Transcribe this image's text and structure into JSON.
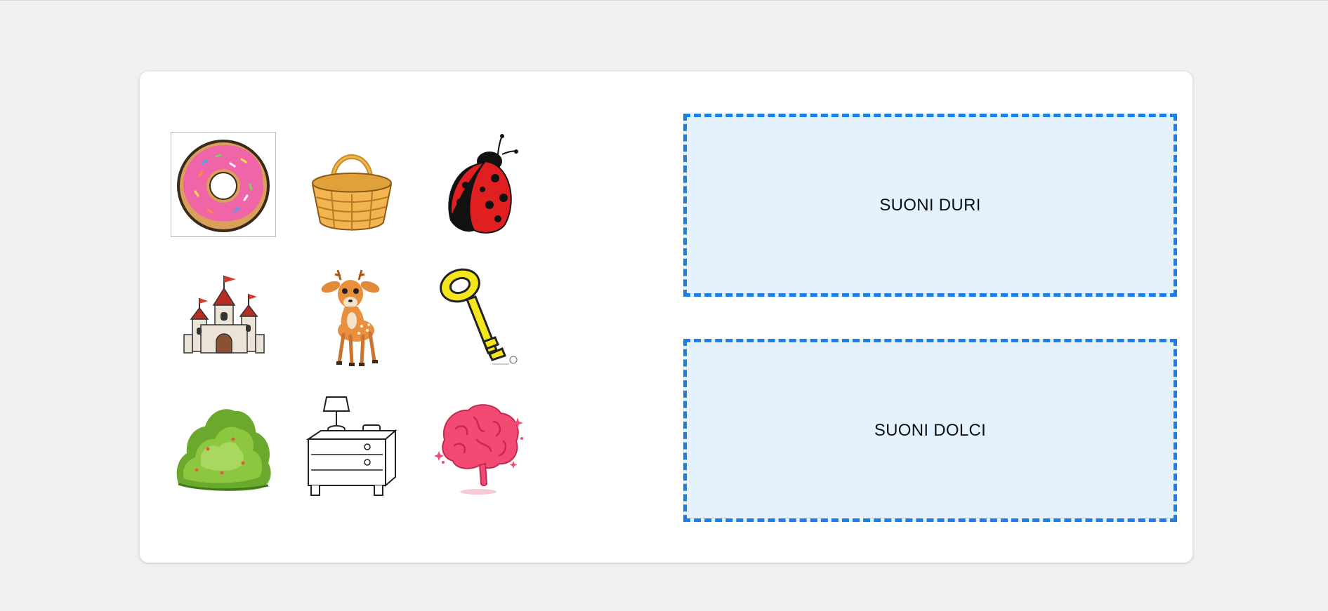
{
  "zones": [
    {
      "label": "SUONI DURI"
    },
    {
      "label": "SUONI DOLCI"
    }
  ],
  "items": [
    {
      "name": "donut",
      "icon": "donut-icon"
    },
    {
      "name": "cesto",
      "icon": "basket-icon"
    },
    {
      "name": "coccinella",
      "icon": "ladybug-icon"
    },
    {
      "name": "castello",
      "icon": "castle-icon"
    },
    {
      "name": "cerbiatto",
      "icon": "deer-icon"
    },
    {
      "name": "chiave",
      "icon": "key-icon"
    },
    {
      "name": "cespuglio",
      "icon": "bush-icon"
    },
    {
      "name": "comodino",
      "icon": "nightstand-icon"
    },
    {
      "name": "cervello",
      "icon": "brain-icon"
    }
  ],
  "colors": {
    "page_bg": "#f0f0f0",
    "card_bg": "#ffffff",
    "zone_bg": "#e3f2fd",
    "zone_border": "#1a7fe8"
  }
}
